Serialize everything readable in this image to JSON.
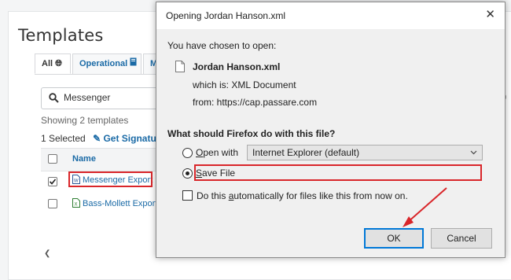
{
  "page": {
    "title": "Templates",
    "tabs": [
      {
        "label": "All"
      },
      {
        "label": "Operational"
      },
      {
        "label": "M"
      }
    ],
    "search": {
      "value": "Messenger"
    },
    "showing_text": "Showing 2 templates",
    "selected_text": "1 Selected",
    "get_signature_label": "Get Signature",
    "table": {
      "header_name": "Name",
      "rows": [
        {
          "name": "Messenger Export",
          "checked": true
        },
        {
          "name": "Bass-Mollett Export",
          "checked": false
        }
      ]
    }
  },
  "dialog": {
    "title": "Opening Jordan Hanson.xml",
    "chosen_label": "You have chosen to open:",
    "file_name": "Jordan Hanson.xml",
    "which_is": "which is:  XML Document",
    "from": "from:  https://cap.passare.com",
    "question": "What should Firefox do with this file?",
    "open_with_prefix": "O",
    "open_with_rest": "pen with",
    "open_with_app": "Internet Explorer (default)",
    "save_file_prefix": "S",
    "save_file_rest": "ave File",
    "auto_prefix": "Do this ",
    "auto_u": "a",
    "auto_rest": "utomatically for files like this from now on.",
    "ok_label": "OK",
    "cancel_label": "Cancel",
    "selected_option": "save-file"
  },
  "colors": {
    "accent_link": "#1a6aa6",
    "annotation_red": "#d9262a",
    "default_button_border": "#0078d7"
  }
}
